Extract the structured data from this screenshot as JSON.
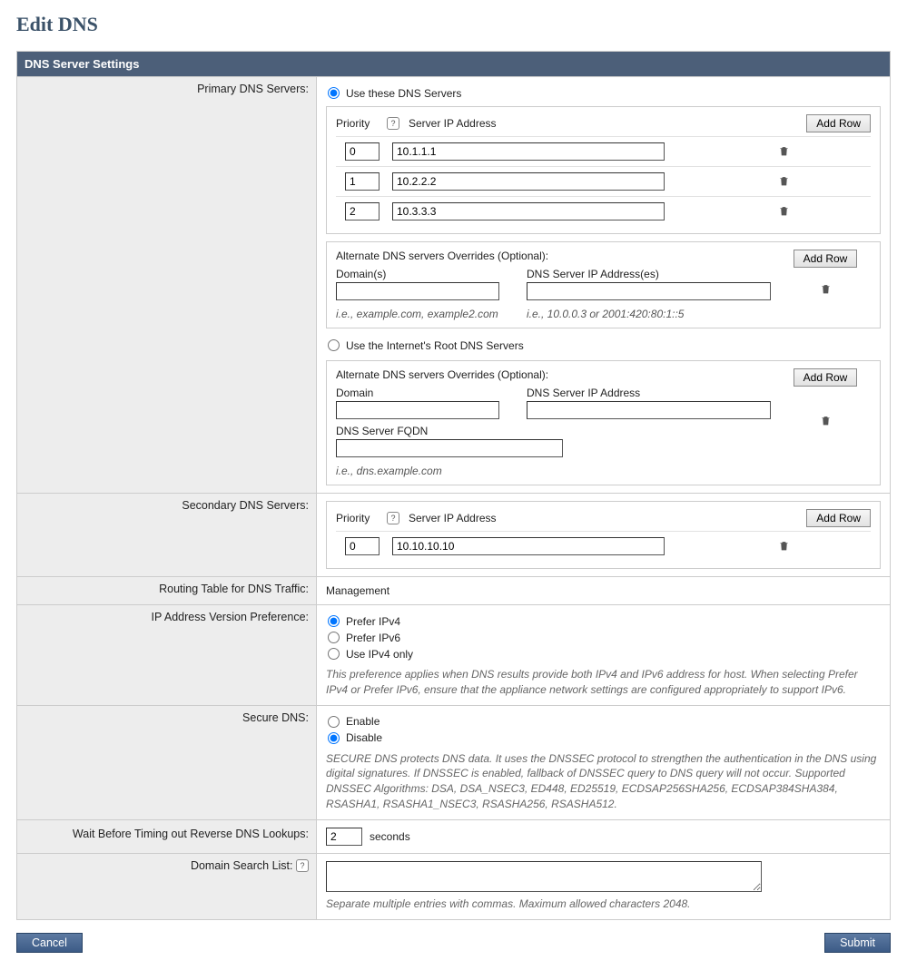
{
  "page": {
    "title": "Edit DNS"
  },
  "section_header": "DNS Server Settings",
  "labels": {
    "primary": "Primary DNS Servers:",
    "secondary": "Secondary DNS Servers:",
    "routing": "Routing Table for DNS Traffic:",
    "ip_pref": "IP Address Version Preference:",
    "secure": "Secure DNS:",
    "wait": "Wait Before Timing out Reverse DNS Lookups:",
    "search": "Domain Search List:"
  },
  "primary": {
    "radio_use": "Use these DNS Servers",
    "radio_root": "Use the Internet's Root DNS Servers",
    "headers": {
      "priority": "Priority",
      "server_ip": "Server IP Address"
    },
    "add_row": "Add Row",
    "rows": [
      {
        "priority": "0",
        "ip": "10.1.1.1"
      },
      {
        "priority": "1",
        "ip": "10.2.2.2"
      },
      {
        "priority": "2",
        "ip": "10.3.3.3"
      }
    ],
    "alt1": {
      "title": "Alternate DNS servers Overrides (Optional):",
      "domain_label": "Domain(s)",
      "ip_label": "DNS Server IP Address(es)",
      "domain_value": "",
      "ip_value": "",
      "hint_domain": "i.e., example.com, example2.com",
      "hint_ip": "i.e., 10.0.0.3 or 2001:420:80:1::5",
      "add_row": "Add Row"
    },
    "alt2": {
      "title": "Alternate DNS servers Overrides (Optional):",
      "domain_label": "Domain",
      "ip_label": "DNS Server IP Address",
      "fqdn_label": "DNS Server FQDN",
      "domain_value": "",
      "ip_value": "",
      "fqdn_value": "",
      "hint_fqdn": "i.e., dns.example.com",
      "add_row": "Add Row"
    }
  },
  "secondary": {
    "headers": {
      "priority": "Priority",
      "server_ip": "Server IP Address"
    },
    "add_row": "Add Row",
    "rows": [
      {
        "priority": "0",
        "ip": "10.10.10.10"
      }
    ]
  },
  "routing_value": "Management",
  "ip_pref": {
    "opt1": "Prefer IPv4",
    "opt2": "Prefer IPv6",
    "opt3": "Use IPv4 only",
    "desc": "This preference applies when DNS results provide both IPv4 and IPv6 address for host. When selecting Prefer IPv4 or Prefer IPv6, ensure that the appliance network settings are configured appropriately to support IPv6."
  },
  "secure": {
    "enable": "Enable",
    "disable": "Disable",
    "desc": "SECURE DNS protects DNS data. It uses the DNSSEC protocol to strengthen the authentication in the DNS using digital signatures. If DNSSEC is enabled, fallback of DNSSEC query to DNS query will not occur. Supported DNSSEC Algorithms: DSA, DSA_NSEC3, ED448, ED25519, ECDSAP256SHA256, ECDSAP384SHA384, RSASHA1, RSASHA1_NSEC3, RSASHA256, RSASHA512."
  },
  "wait_value": "2",
  "wait_unit": "seconds",
  "search_value": "",
  "search_hint": "Separate multiple entries with commas. Maximum allowed characters 2048.",
  "buttons": {
    "cancel": "Cancel",
    "submit": "Submit"
  }
}
